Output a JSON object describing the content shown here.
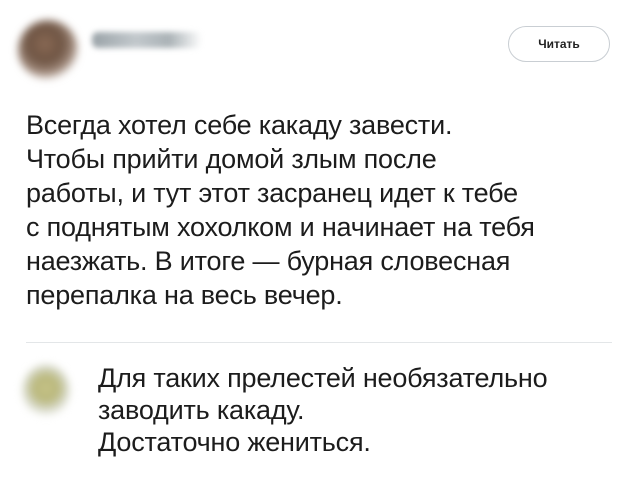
{
  "post": {
    "author_name": "",
    "read_button_label": "Читать",
    "text_lines": [
      "Всегда хотел себе какаду завести.",
      "Чтобы прийти домой злым после",
      "работы, и тут этот засранец идет к тебе",
      "с поднятым хохолком и начинает на тебя",
      "наезжать. В итоге — бурная словесная",
      "перепалка на весь вечер."
    ]
  },
  "comment": {
    "text_lines": [
      "Для таких прелестей необязательно",
      "заводить какаду.",
      "Достаточно жениться."
    ]
  },
  "colors": {
    "text": "#1c1c1c",
    "button_border": "#c9ced3",
    "divider": "#e3e6e8",
    "background": "#ffffff"
  }
}
